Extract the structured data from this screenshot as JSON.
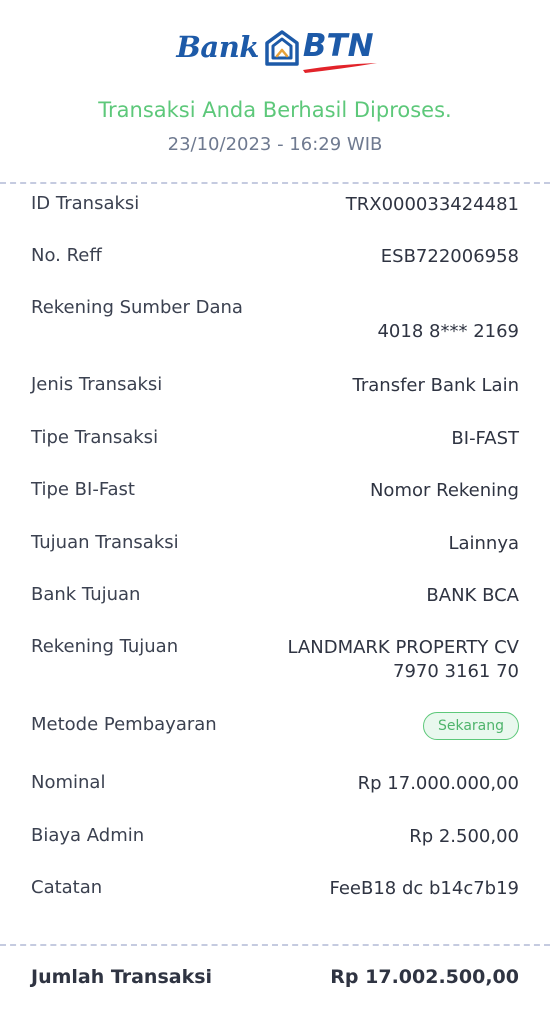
{
  "brand": {
    "bank_word": "Bank",
    "btn_word": "BTN",
    "primary_color": "#1d5aa8",
    "accent_color": "#e2232a"
  },
  "status": {
    "message": "Transaksi Anda Berhasil Diproses.",
    "datetime": "23/10/2023 - 16:29 WIB",
    "success_color": "#5dc87a"
  },
  "details": {
    "id_transaksi": {
      "label": "ID Transaksi",
      "value": "TRX000033424481"
    },
    "no_reff": {
      "label": "No. Reff",
      "value": "ESB722006958"
    },
    "rekening_sumber": {
      "label": "Rekening Sumber Dana",
      "value": "4018 8*** 2169"
    },
    "jenis_transaksi": {
      "label": "Jenis Transaksi",
      "value": "Transfer Bank Lain"
    },
    "tipe_transaksi": {
      "label": "Tipe Transaksi",
      "value": "BI-FAST"
    },
    "tipe_bifast": {
      "label": "Tipe BI-Fast",
      "value": "Nomor Rekening"
    },
    "tujuan_transaksi": {
      "label": "Tujuan Transaksi",
      "value": "Lainnya"
    },
    "bank_tujuan": {
      "label": "Bank Tujuan",
      "value": "BANK BCA"
    },
    "rekening_tujuan": {
      "label": "Rekening Tujuan",
      "name": "LANDMARK PROPERTY CV",
      "number": "7970 3161 70"
    },
    "metode_pembayaran": {
      "label": "Metode Pembayaran",
      "value": "Sekarang"
    },
    "nominal": {
      "label": "Nominal",
      "value": "Rp 17.000.000,00"
    },
    "biaya_admin": {
      "label": "Biaya Admin",
      "value": "Rp 2.500,00"
    },
    "catatan": {
      "label": "Catatan",
      "value": "FeeB18 dc b14c7b19"
    }
  },
  "total": {
    "label": "Jumlah Transaksi",
    "value": "Rp 17.002.500,00"
  }
}
